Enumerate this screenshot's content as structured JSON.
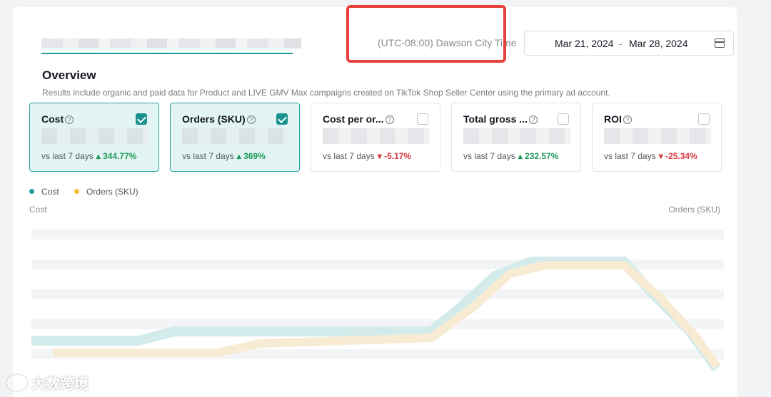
{
  "timezone": "(UTC-08:00) Dawson City Time",
  "date_range": {
    "start": "Mar 21, 2024",
    "separator": "-",
    "end": "Mar 28, 2024"
  },
  "overview": {
    "title": "Overview",
    "subtitle": "Results include organic and paid data for Product and LIVE GMV Max campaigns created on TikTok Shop Seller Center using the primary ad account."
  },
  "metrics": [
    {
      "title": "Cost",
      "checked": true,
      "compare_label": "vs last 7 days",
      "delta": "344.77%",
      "direction": "up"
    },
    {
      "title": "Orders (SKU)",
      "checked": true,
      "compare_label": "vs last 7 days",
      "delta": "369%",
      "direction": "up"
    },
    {
      "title": "Cost per or...",
      "checked": false,
      "compare_label": "vs last 7 days",
      "delta": "-5.17%",
      "direction": "down"
    },
    {
      "title": "Total gross ...",
      "checked": false,
      "compare_label": "vs last 7 days",
      "delta": "232.57%",
      "direction": "up"
    },
    {
      "title": "ROI",
      "checked": false,
      "compare_label": "vs last 7 days",
      "delta": "-25.34%",
      "direction": "down"
    }
  ],
  "legend": [
    {
      "label": "Cost",
      "color": "#1a9c9c"
    },
    {
      "label": "Orders (SKU)",
      "color": "#f5bd3c"
    }
  ],
  "axis": {
    "left": "Cost",
    "right": "Orders (SKU)"
  },
  "watermark": "大数跨境",
  "colors": {
    "accent": "#1a9c9c",
    "up": "#1e9a5a",
    "down": "#d9383e",
    "highlight": "#e8403b"
  }
}
